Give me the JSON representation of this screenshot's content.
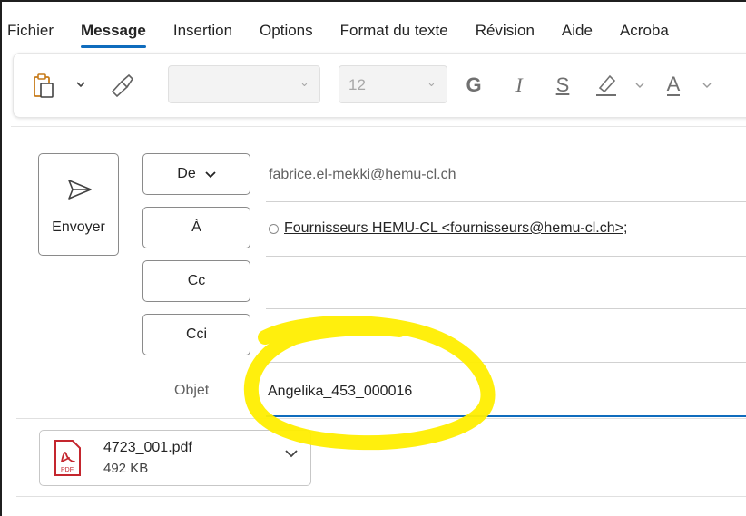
{
  "ribbon": {
    "tabs": [
      {
        "label": "Fichier",
        "active": false
      },
      {
        "label": "Message",
        "active": true
      },
      {
        "label": "Insertion",
        "active": false
      },
      {
        "label": "Options",
        "active": false
      },
      {
        "label": "Format du texte",
        "active": false
      },
      {
        "label": "Révision",
        "active": false
      },
      {
        "label": "Aide",
        "active": false
      },
      {
        "label": "Acroba",
        "active": false
      }
    ]
  },
  "toolbar": {
    "paste_icon": "clipboard-icon",
    "format_painter_icon": "format-painter-icon",
    "font_name": "",
    "font_size": "12",
    "bold_glyph": "G",
    "italic_glyph": "I",
    "underline_glyph": "S",
    "highlight_icon": "highlighter-icon",
    "font_color_glyph": "A"
  },
  "compose": {
    "send_label": "Envoyer",
    "from_button": "De",
    "to_button": "À",
    "cc_button": "Cc",
    "bcc_button": "Cci",
    "from_value": "fabrice.el-mekki@hemu-cl.ch",
    "to_recipient": "Fournisseurs HEMU-CL <fournisseurs@hemu-cl.ch>",
    "to_separator": ";",
    "cc_value": "",
    "bcc_value": "",
    "subject_label": "Objet",
    "subject_value": "Angelika_453_000016"
  },
  "attachment": {
    "file_name": "4723_001.pdf",
    "file_size": "492 KB",
    "file_type_badge": "PDF"
  },
  "colors": {
    "accent": "#0f6cbd",
    "pdf_red": "#c4262e",
    "highlight_yellow": "#ffee00"
  }
}
